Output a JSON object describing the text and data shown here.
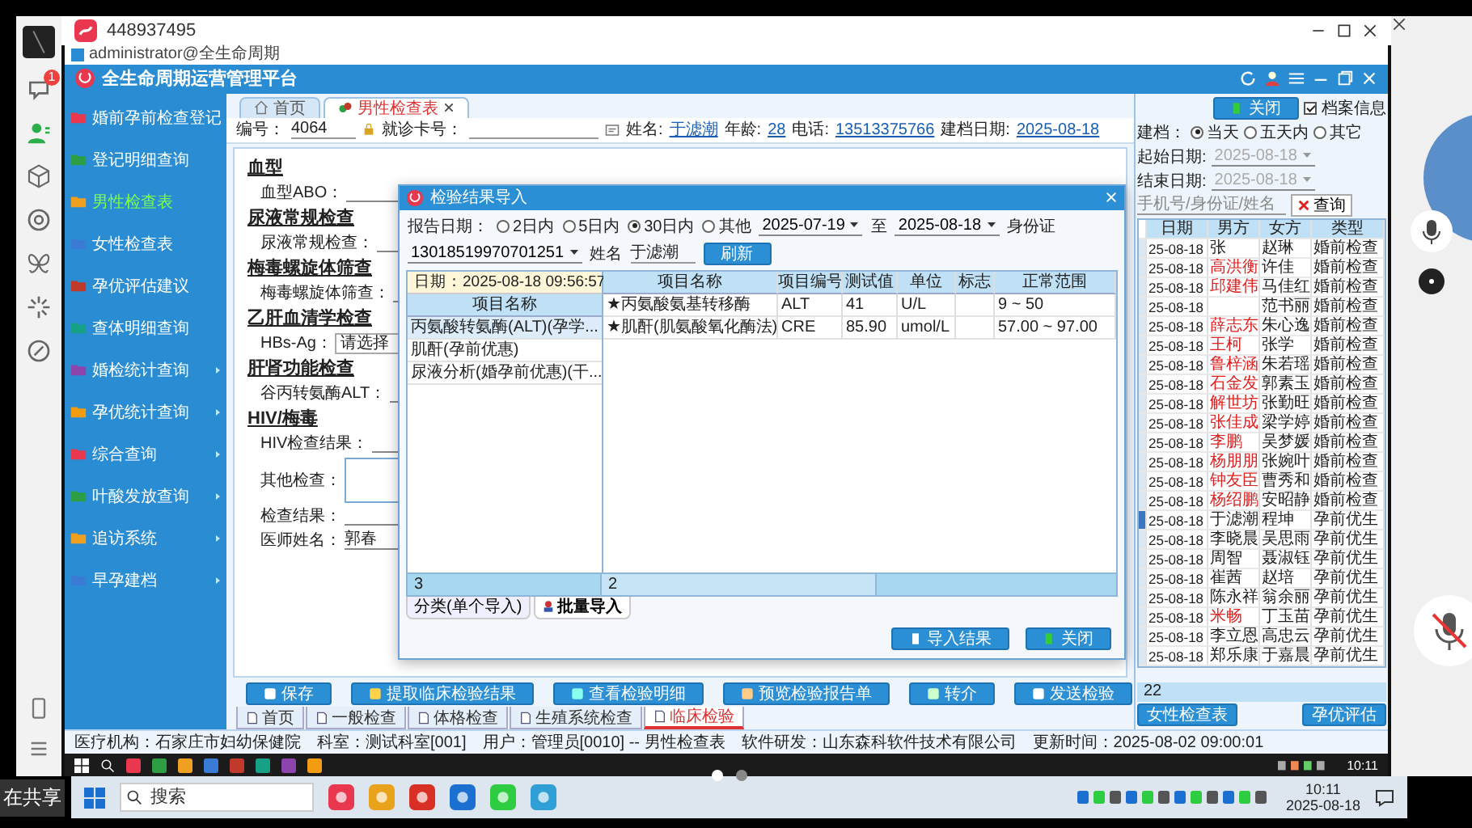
{
  "share_label": "在共享",
  "pager": [
    {
      "selected": true
    },
    {
      "selected": false
    }
  ],
  "client_sidebar": {
    "badge": "1"
  },
  "window": {
    "title": "448937495"
  },
  "app": {
    "login_line": "administrator@全生命周期",
    "title": "全生命周期运营管理平台",
    "sidebar": [
      {
        "label": "婚前孕前检查登记",
        "selected": false,
        "submenu": false
      },
      {
        "label": "登记明细查询",
        "selected": false,
        "submenu": false
      },
      {
        "label": "男性检查表",
        "selected": true,
        "submenu": false
      },
      {
        "label": "女性检查表",
        "selected": false,
        "submenu": false
      },
      {
        "label": "孕优评估建议",
        "selected": false,
        "submenu": false
      },
      {
        "label": "查体明细查询",
        "selected": false,
        "submenu": false
      },
      {
        "label": "婚检统计查询",
        "selected": false,
        "submenu": true
      },
      {
        "label": "孕优统计查询",
        "selected": false,
        "submenu": true
      },
      {
        "label": "综合查询",
        "selected": false,
        "submenu": true
      },
      {
        "label": "叶酸发放查询",
        "selected": false,
        "submenu": true
      },
      {
        "label": "追访系统",
        "selected": false,
        "submenu": true
      },
      {
        "label": "早孕建档",
        "selected": false,
        "submenu": true
      }
    ],
    "tabs": [
      {
        "label": "首页",
        "selected": false,
        "closable": false
      },
      {
        "label": "男性检查表",
        "selected": true,
        "closable": true
      }
    ],
    "patient_bar": {
      "id_label": "编号：",
      "id_value": "4064",
      "card_label": "就诊卡号：",
      "fields": [
        {
          "label": "姓名:",
          "value": "于滤潮"
        },
        {
          "label": "年龄:",
          "value": "28"
        },
        {
          "label": "电话:",
          "value": "13513375766"
        },
        {
          "label": "建档日期:",
          "value": "2025-08-18"
        }
      ]
    },
    "form": {
      "sections": [
        {
          "title": "血型",
          "fields": [
            {
              "label": "血型ABO：",
              "kind": "line"
            }
          ]
        },
        {
          "title": "尿液常规检查",
          "fields": [
            {
              "label": "尿液常规检查：",
              "kind": "line"
            }
          ]
        },
        {
          "title": "梅毒螺旋体筛查",
          "fields": [
            {
              "label": "梅毒螺旋体筛查：",
              "kind": "line"
            }
          ]
        },
        {
          "title": "乙肝血清学检查",
          "fields": [
            {
              "label": "HBs-Ag：",
              "kind": "select",
              "value": "请选择"
            }
          ]
        },
        {
          "title": "肝肾功能检查",
          "fields": [
            {
              "label": "谷丙转氨酶ALT：",
              "kind": "line"
            }
          ]
        },
        {
          "title": "HIV/梅毒",
          "fields": [
            {
              "label": "HIV检查结果：",
              "kind": "line"
            }
          ]
        }
      ],
      "extra_fields": [
        {
          "label": "其他检查：",
          "kind": "area"
        },
        {
          "label": "检查结果：",
          "kind": "line"
        },
        {
          "label": "医师姓名：",
          "kind": "line",
          "value": "郭春"
        }
      ]
    },
    "dialog": {
      "title": "检验结果导入",
      "filter": {
        "label": "报告日期：",
        "ranges": [
          {
            "label": "2日内",
            "selected": false
          },
          {
            "label": "5日内",
            "selected": false
          },
          {
            "label": "30日内",
            "selected": true
          },
          {
            "label": "其他",
            "selected": false
          }
        ],
        "from": "2025-07-19",
        "to_label": "至",
        "to": "2025-08-18",
        "id_label": "身份证",
        "id_value": "13018519970701251",
        "name_label": "姓名",
        "name_value": "于滤潮",
        "refresh_button": "刷新"
      },
      "left_grid": {
        "date_header": "日期：2025-08-18 09:56:57",
        "column": "项目名称",
        "count": "3",
        "rows": [
          {
            "name": "丙氨酸转氨酶(ALT)(孕学...",
            "selected": true
          },
          {
            "name": "肌酐(孕前优惠)",
            "selected": false
          },
          {
            "name": "尿液分析(婚孕前优惠)(干...",
            "selected": false
          }
        ]
      },
      "right_grid": {
        "columns": [
          "项目名称",
          "项目编号",
          "测试值",
          "单位",
          "标志",
          "正常范围"
        ],
        "count": "2",
        "rows": [
          {
            "name": "★丙氨酸氨基转移酶",
            "code": "ALT",
            "value": "41",
            "unit": "U/L",
            "range": "9 ~ 50"
          },
          {
            "name": "★肌酐(肌氨酸氧化酶法)",
            "code": "CRE",
            "value": "85.90",
            "unit": "umol/L",
            "range": "57.00 ~ 97.00"
          }
        ]
      },
      "tabs": [
        {
          "label": "分类(单个导入)",
          "selected": false
        },
        {
          "label": "批量导入",
          "selected": true
        }
      ],
      "buttons": [
        {
          "label": "导入结果",
          "kind": "import"
        },
        {
          "label": "关闭",
          "kind": "close"
        }
      ]
    },
    "action_buttons": [
      {
        "label": "保存",
        "kind": "save"
      },
      {
        "label": "提取临床检验结果",
        "kind": "fetch"
      },
      {
        "label": "查看检验明细",
        "kind": "view"
      },
      {
        "label": "预览检验报告单",
        "kind": "preview"
      },
      {
        "label": "转介",
        "kind": "refer"
      },
      {
        "label": "发送检验",
        "kind": "send"
      }
    ],
    "bottom_tabs": [
      {
        "label": "首页",
        "selected": false
      },
      {
        "label": "一般检查",
        "selected": false
      },
      {
        "label": "体格检查",
        "selected": false
      },
      {
        "label": "生殖系统检查",
        "selected": false
      },
      {
        "label": "临床检验",
        "selected": true
      }
    ],
    "status_bar": [
      "医疗机构：石家庄市妇幼保健院",
      "科室：测试科室[001]",
      "用户：管理员[0010] -- 男性检查表",
      "软件研发：山东森科软件技术有限公司",
      "更新时间：2025-08-02 09:00:01"
    ],
    "right_panel": {
      "close_button": "关闭",
      "archive_checkbox": {
        "label": "档案信息",
        "checked": true
      },
      "date_mode": {
        "label": "建档：",
        "options": [
          {
            "label": "当天",
            "selected": true
          },
          {
            "label": "五天内",
            "selected": false
          },
          {
            "label": "其它",
            "selected": false
          }
        ]
      },
      "start_date": {
        "label": "起始日期:",
        "value": "2025-08-18",
        "disabled": true
      },
      "end_date": {
        "label": "结束日期:",
        "value": "2025-08-18",
        "disabled": true
      },
      "search": {
        "placeholder": "手机号/身份证/姓名"
      },
      "search_button": "查询",
      "columns": [
        "日期",
        "男方",
        "女方",
        "类型"
      ],
      "rows": [
        {
          "date": "25-08-18",
          "male": "张",
          "female": "赵琳",
          "type": "婚前检查",
          "color": "#222222",
          "selected": false
        },
        {
          "date": "25-08-18",
          "male": "高洪衡",
          "female": "许佳",
          "type": "婚前检查",
          "color": "#e02020",
          "selected": false
        },
        {
          "date": "25-08-18",
          "male": "邱建伟",
          "female": "马佳红",
          "type": "婚前检查",
          "color": "#e02020",
          "selected": false
        },
        {
          "date": "25-08-18",
          "female": "范书丽",
          "type": "婚前检查",
          "selected": false
        },
        {
          "date": "25-08-18",
          "male": "薛志东",
          "female": "朱心逸",
          "type": "婚前检查",
          "color": "#e02020",
          "selected": false
        },
        {
          "date": "25-08-18",
          "male": "王柯",
          "female": "张学",
          "type": "婚前检查",
          "color": "#e02020",
          "selected": false
        },
        {
          "date": "25-08-18",
          "male": "鲁梓涵",
          "female": "朱若瑶",
          "type": "婚前检查",
          "color": "#e02020",
          "selected": false
        },
        {
          "date": "25-08-18",
          "male": "石金发",
          "female": "郭素玉",
          "type": "婚前检查",
          "color": "#e02020",
          "selected": false
        },
        {
          "date": "25-08-18",
          "male": "解世坊",
          "female": "张勤旺",
          "type": "婚前检查",
          "color": "#e02020",
          "selected": false
        },
        {
          "date": "25-08-18",
          "male": "张佳成",
          "female": "梁学婷",
          "type": "婚前检查",
          "color": "#e02020",
          "selected": false
        },
        {
          "date": "25-08-18",
          "male": "李鹏",
          "female": "吴梦媛",
          "type": "婚前检查",
          "color": "#e02020",
          "selected": false
        },
        {
          "date": "25-08-18",
          "male": "杨朋朋",
          "female": "张婉叶",
          "type": "婚前检查",
          "color": "#e02020",
          "selected": false
        },
        {
          "date": "25-08-18",
          "male": "钟友臣",
          "female": "曹秀和",
          "type": "婚前检查",
          "color": "#e02020",
          "selected": false
        },
        {
          "date": "25-08-18",
          "male": "杨绍鹏",
          "female": "安昭静",
          "type": "婚前检查",
          "color": "#e02020",
          "selected": false
        },
        {
          "date": "25-08-18",
          "male": "于滤潮",
          "female": "程坤",
          "type": "孕前优生",
          "color": "#222222",
          "selected": true
        },
        {
          "date": "25-08-18",
          "male": "李晓晨",
          "female": "吴思雨",
          "type": "孕前优生",
          "color": "#222222",
          "selected": false
        },
        {
          "date": "25-08-18",
          "male": "周智",
          "female": "聂淑钰",
          "type": "孕前优生",
          "color": "#222222",
          "selected": false
        },
        {
          "date": "25-08-18",
          "male": "崔茜",
          "female": "赵培",
          "type": "孕前优生",
          "color": "#222222",
          "selected": false
        },
        {
          "date": "25-08-18",
          "male": "陈永祥",
          "female": "翁余丽",
          "type": "孕前优生",
          "color": "#222222",
          "selected": false
        },
        {
          "date": "25-08-18",
          "male": "米畅",
          "female": "丁玉苗",
          "type": "孕前优生",
          "color": "#e02020",
          "selected": false
        },
        {
          "date": "25-08-18",
          "male": "李立恩",
          "female": "高忠云",
          "type": "孕前优生",
          "color": "#222222",
          "selected": false
        },
        {
          "date": "25-08-18",
          "male": "郑乐康",
          "female": "于嘉晨",
          "type": "孕前优生",
          "color": "#222222",
          "selected": false
        }
      ],
      "count": "22",
      "buttons": [
        "女性检查表",
        "孕优评估"
      ]
    },
    "taskbar_time": "10:11"
  },
  "outer_taskbar": {
    "search": {
      "placeholder": "搜索"
    },
    "time": "10:11",
    "date": "2025-08-18"
  }
}
